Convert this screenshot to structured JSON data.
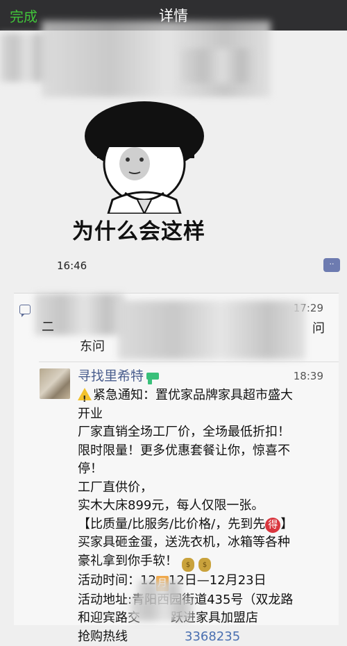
{
  "nav": {
    "back": "完成",
    "title": "详情"
  },
  "meme": {
    "caption": "为什么会这样"
  },
  "time1": "16:46",
  "card": {
    "time2": "17:29",
    "frag1": "二",
    "frag2": "东问",
    "frag3": "问",
    "username": "寻找里希特",
    "time3": "18:39",
    "lines": [
      "紧急通知：置优家品牌家具超市盛大",
      "开业",
      "厂家直销全场工厂价，全场最低折扣！",
      "限时限量！更多优惠套餐让你，惊喜不",
      "停！",
      "工厂直供价，",
      "实木大床899元，每人仅限一张。"
    ],
    "line8_pre": "【比质量/比服务/比价格/，先到先",
    "line8_badge": "得",
    "line8_post": "】",
    "line9": "买家具砸金蛋，送洗衣机，冰箱等各种",
    "line10": "豪礼拿到你手软！",
    "line11_pre": "活动时间：12",
    "line11_icon": "月",
    "line11_post": "12日—12月23日",
    "line12": " 活动地址:青阳西园街道435号（双龙路",
    "line13_pre": "和迎宾路交",
    "line13_post": "跃进家具加盟店",
    "line14_pre": "抢购热线",
    "line14_post": "3368235"
  }
}
